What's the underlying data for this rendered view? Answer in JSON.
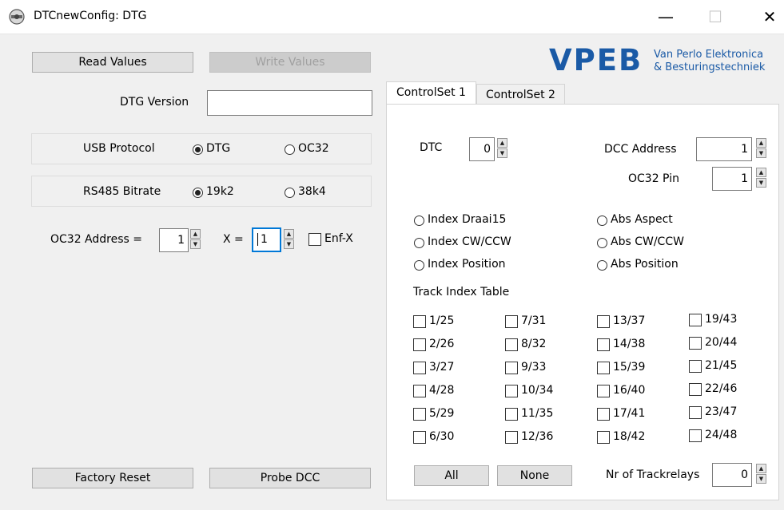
{
  "window": {
    "title": "DTCnewConfig: DTG",
    "controls": {
      "minimize": "—",
      "maximize": "☐",
      "close": "✕"
    }
  },
  "logo": {
    "brand": "VPEB",
    "line1": "Van Perlo Elektronica",
    "line2": "& Besturingstechniek",
    "color": "#1a5aa6"
  },
  "left": {
    "read_values": "Read Values",
    "write_values": "Write Values",
    "dtg_version_label": "DTG Version",
    "dtg_version_value": "",
    "usb_protocol_label": "USB Protocol",
    "usb_options": [
      "DTG",
      "OC32"
    ],
    "usb_selected": "DTG",
    "rs485_label": "RS485 Bitrate",
    "rs485_options": [
      "19k2",
      "38k4"
    ],
    "rs485_selected": "19k2",
    "oc32_address_label": "OC32 Address =",
    "oc32_address_value": "1",
    "x_label": "X =",
    "x_value": "1",
    "enf_x_label": "Enf-X",
    "factory_reset": "Factory Reset",
    "probe_dcc": "Probe DCC"
  },
  "tabs": [
    {
      "label": "ControlSet 1",
      "active": true
    },
    {
      "label": "ControlSet 2",
      "active": false
    }
  ],
  "controlset": {
    "dtc_label": "DTC",
    "dtc_value": "0",
    "dcc_address_label": "DCC Address",
    "dcc_address_value": "1",
    "oc32_pin_label": "OC32 Pin",
    "oc32_pin_value": "1",
    "modes_left": [
      "Index Draai15",
      "Index CW/CCW",
      "Index Position"
    ],
    "modes_right": [
      "Abs Aspect",
      "Abs CW/CCW",
      "Abs Position"
    ],
    "track_table_label": "Track Index Table",
    "track_columns": [
      [
        "1/25",
        "2/26",
        "3/27",
        "4/28",
        "5/29",
        "6/30"
      ],
      [
        "7/31",
        "8/32",
        "9/33",
        "10/34",
        "11/35",
        "12/36"
      ],
      [
        "13/37",
        "14/38",
        "15/39",
        "16/40",
        "17/41",
        "18/42"
      ],
      [
        "19/43",
        "20/44",
        "21/45",
        "22/46",
        "23/47",
        "24/48"
      ]
    ],
    "all_button": "All",
    "none_button": "None",
    "nr_trackrelays_label": "Nr of Trackrelays",
    "nr_trackrelays_value": "0"
  }
}
